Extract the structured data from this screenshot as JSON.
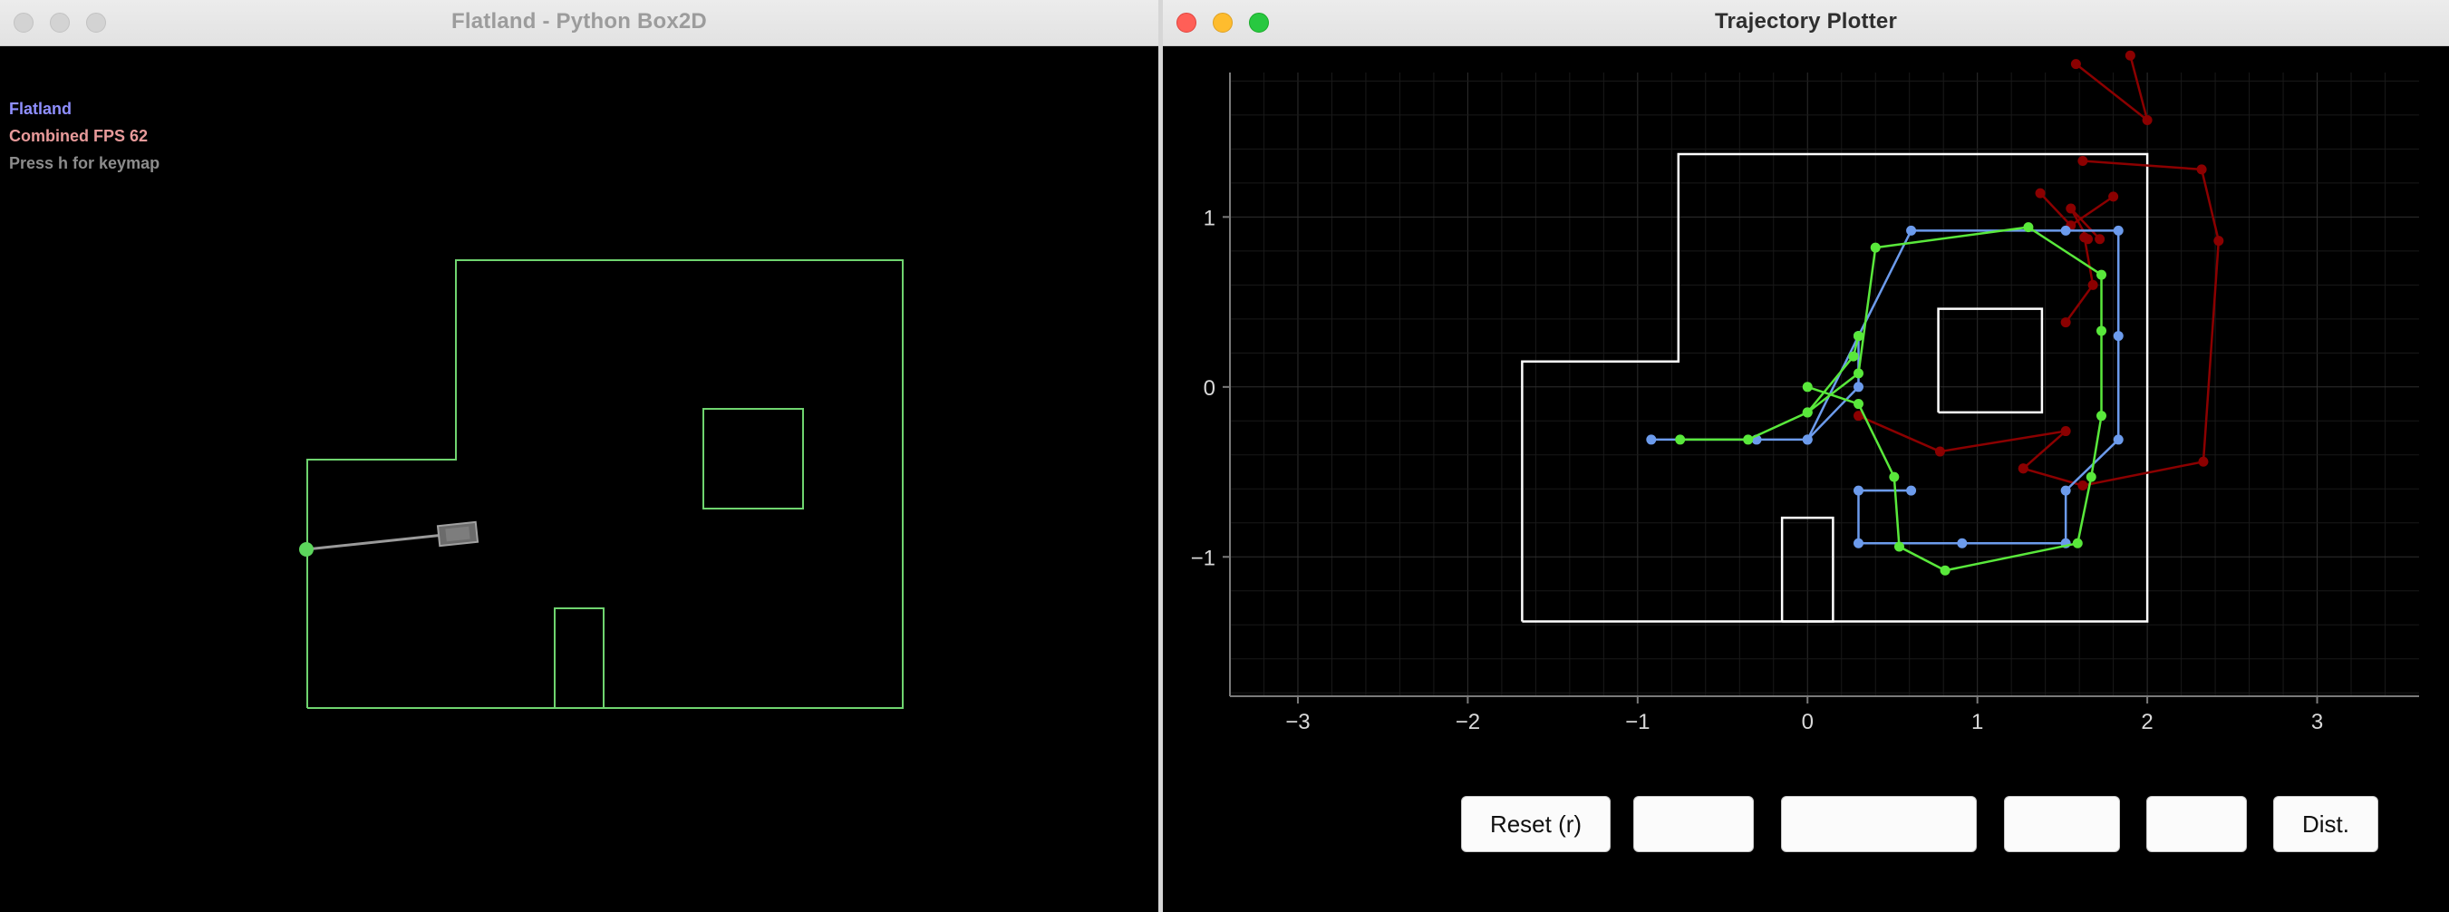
{
  "left_window": {
    "title": "Flatland - Python Box2D",
    "hud": {
      "app_name": "Flatland",
      "fps_label": "Combined FPS 62",
      "hint": "Press h for keymap"
    },
    "colors": {
      "hud_app_name": "#8f8fff",
      "hud_fps": "#e89a9a",
      "hud_hint": "#8c8c8c",
      "walls": "#6fd46f",
      "robot": "#7a7a7a",
      "target": "#5cd65c"
    }
  },
  "right_window": {
    "title": "Trajectory Plotter",
    "buttons": [
      "Reset (r)",
      "",
      "",
      "",
      "",
      "Dist."
    ],
    "chart_data": {
      "type": "line",
      "xlim": [
        -3.4,
        3.6
      ],
      "ylim": [
        -1.82,
        1.85
      ],
      "xticks": [
        -3,
        -2,
        -1,
        0,
        1,
        2,
        3
      ],
      "yticks": [
        -1,
        0,
        1
      ],
      "grid": true,
      "title": "",
      "xlabel": "",
      "ylabel": "",
      "map_outline": [
        [
          -1.68,
          -1.38
        ],
        [
          2.0,
          -1.38
        ],
        [
          2.0,
          1.37
        ],
        [
          -0.76,
          1.37
        ],
        [
          -0.76,
          0.15
        ],
        [
          -1.68,
          0.15
        ],
        [
          -1.68,
          -1.38
        ]
      ],
      "obstacles": [
        [
          [
            0.77,
            -0.15
          ],
          [
            1.38,
            -0.15
          ],
          [
            1.38,
            0.46
          ],
          [
            0.77,
            0.46
          ],
          [
            0.77,
            -0.15
          ]
        ],
        [
          [
            -0.15,
            -1.38
          ],
          [
            0.15,
            -1.38
          ],
          [
            0.15,
            -0.77
          ],
          [
            -0.15,
            -0.77
          ],
          [
            -0.15,
            -1.38
          ]
        ]
      ],
      "series": [
        {
          "color": "#8b0000",
          "x": [
            1.58,
            2.0,
            1.9
          ],
          "y": [
            1.9,
            1.57,
            1.95
          ]
        },
        {
          "color": "#8b0000",
          "x": [
            1.37,
            1.55,
            1.8
          ],
          "y": [
            1.14,
            0.95,
            1.12
          ]
        },
        {
          "color": "#8b0000",
          "x": [
            1.65,
            1.55,
            1.72
          ],
          "y": [
            0.87,
            1.05,
            0.87
          ]
        },
        {
          "color": "#8b0000",
          "x": [
            1.62,
            2.32,
            2.42,
            2.33,
            1.62,
            1.27
          ],
          "y": [
            1.33,
            1.28,
            0.86,
            -0.44,
            -0.58,
            -0.48
          ]
        },
        {
          "color": "#8b0000",
          "x": [
            1.27,
            1.52,
            0.78,
            0.3
          ],
          "y": [
            -0.48,
            -0.26,
            -0.38,
            -0.17
          ]
        },
        {
          "color": "#8b0000",
          "x": [
            1.52,
            1.68,
            1.63
          ],
          "y": [
            0.38,
            0.6,
            0.88
          ]
        },
        {
          "color": "#6c9bec",
          "x": [
            -0.92,
            -0.3,
            0.0,
            0.3,
            0.61,
            1.52,
            1.83,
            1.83,
            1.83,
            1.52,
            1.52,
            0.91,
            0.3,
            0.3,
            0.61
          ],
          "y": [
            -0.31,
            -0.31,
            -0.31,
            0.3,
            0.92,
            0.92,
            0.92,
            0.3,
            -0.31,
            -0.61,
            -0.92,
            -0.92,
            -0.92,
            -0.61,
            -0.61
          ]
        },
        {
          "color": "#6c9bec",
          "x": [
            0.0,
            0.3,
            0.3
          ],
          "y": [
            -0.31,
            0.0,
            0.3
          ]
        },
        {
          "color": "#59e83b",
          "x": [
            -0.75,
            -0.35,
            0.0,
            0.3,
            0.4,
            1.3,
            1.73,
            1.73,
            1.73,
            1.67,
            1.59,
            0.81,
            0.54,
            0.51,
            0.3,
            0.0
          ],
          "y": [
            -0.31,
            -0.31,
            -0.15,
            0.08,
            0.82,
            0.94,
            0.66,
            0.33,
            -0.17,
            -0.53,
            -0.92,
            -1.08,
            -0.94,
            -0.53,
            -0.1,
            0.0
          ]
        },
        {
          "color": "#59e83b",
          "x": [
            0.0,
            0.27,
            0.3
          ],
          "y": [
            -0.15,
            0.18,
            0.3
          ]
        }
      ]
    }
  }
}
